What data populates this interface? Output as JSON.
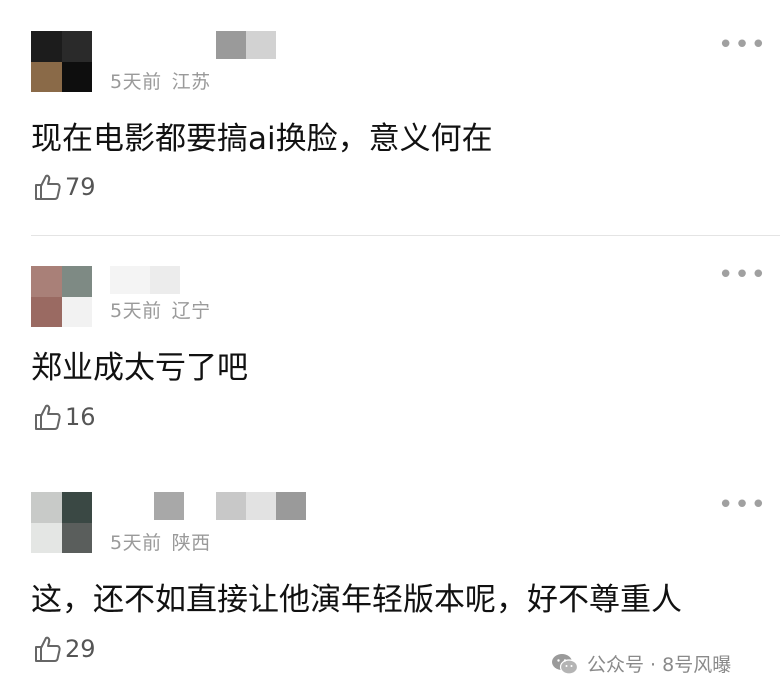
{
  "comments": [
    {
      "time": "5天前",
      "location": "江苏",
      "text": "现在电影都要搞ai换脸，意义何在",
      "likes": "79",
      "avatar_colors": [
        "#1c1c1c",
        "#2a2a2a",
        "#8a6a48",
        "#0e0e0e"
      ],
      "name_colors": [
        "#9a9a9a",
        "#d2d2d2"
      ]
    },
    {
      "time": "5天前",
      "location": "辽宁",
      "text": "郑业成太亏了吧",
      "likes": "16",
      "avatar_colors": [
        "#a98078",
        "#7e8a84",
        "#9a6a62",
        "#f2f2f2"
      ],
      "name_colors": [
        "#f4f4f4",
        "#ececec"
      ]
    },
    {
      "time": "5天前",
      "location": "陕西",
      "text": "这，还不如直接让他演年轻版本呢，好不尊重人",
      "likes": "29",
      "avatar_colors": [
        "#c8cac8",
        "#3a4844",
        "#e4e6e4",
        "#5a5e5c"
      ],
      "name_colors": [
        "#a8a8a8",
        "#c8c8c8",
        "#e2e2e2",
        "#9a9a9a"
      ]
    }
  ],
  "more_icon": "more-dots-icon",
  "like_icon": "thumbs-up-icon",
  "watermark": {
    "icon": "wechat-icon",
    "text": "公众号 · 8号风曝"
  }
}
